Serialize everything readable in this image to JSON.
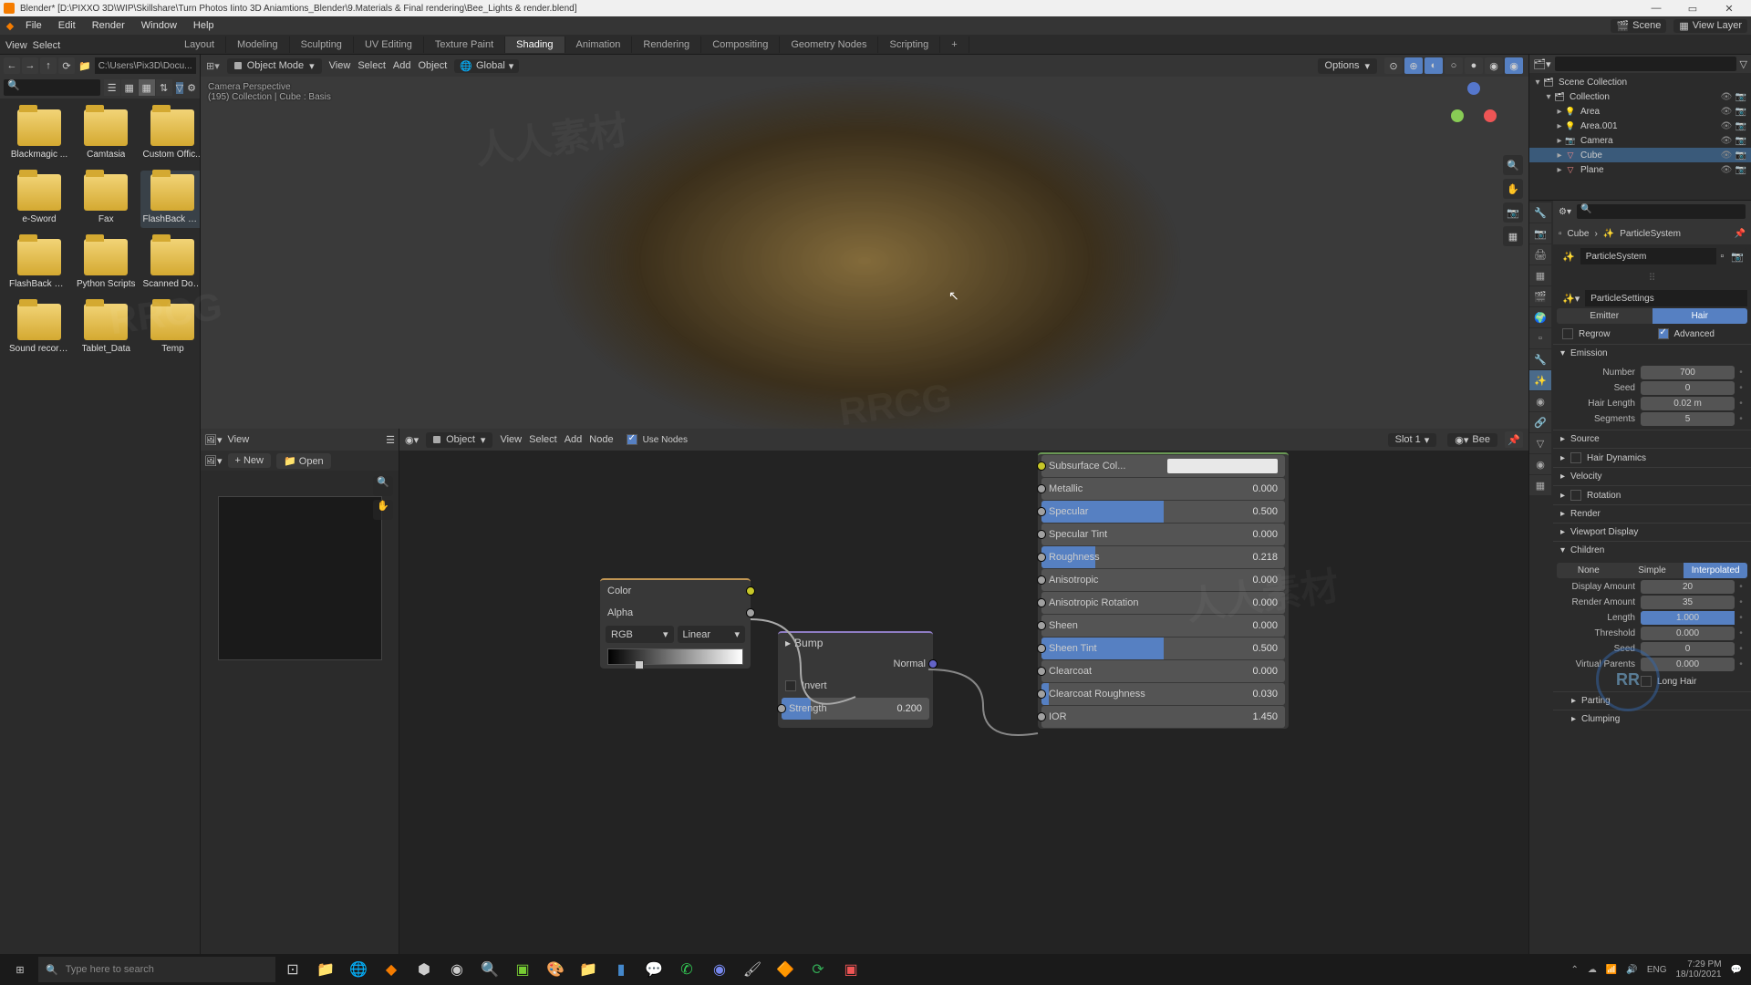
{
  "window": {
    "title": "Blender* [D:\\PIXXO 3D\\WIP\\Skillshare\\Turn Photos Iinto 3D Aniamtions_Blender\\9.Materials & Final rendering\\Bee_Lights & render.blend]"
  },
  "menubar": [
    "File",
    "Edit",
    "Render",
    "Window",
    "Help"
  ],
  "scene_name": "Scene",
  "viewlayer_name": "View Layer",
  "workspace_tabs": [
    "Layout",
    "Modeling",
    "Sculpting",
    "UV Editing",
    "Texture Paint",
    "Shading",
    "Animation",
    "Rendering",
    "Compositing",
    "Geometry Nodes",
    "Scripting"
  ],
  "active_workspace": "Shading",
  "topbar_menus": [
    "View",
    "Select"
  ],
  "filebrowser": {
    "path": "C:\\Users\\Pix3D\\Docu...",
    "search_placeholder": "",
    "items": [
      {
        "name": "Blackmagic ..."
      },
      {
        "name": "Camtasia"
      },
      {
        "name": "Custom Offic..."
      },
      {
        "name": "e-Sword"
      },
      {
        "name": "Fax"
      },
      {
        "name": "FlashBack Mo...",
        "selected": true
      },
      {
        "name": "FlashBack Pr..."
      },
      {
        "name": "Python Scripts"
      },
      {
        "name": "Scanned Doc..."
      },
      {
        "name": "Sound recordi..."
      },
      {
        "name": "Tablet_Data"
      },
      {
        "name": "Temp"
      }
    ]
  },
  "viewport": {
    "mode": "Object Mode",
    "menus": [
      "View",
      "Select",
      "Add",
      "Object"
    ],
    "overlay_top": "Camera Perspective",
    "overlay_frame": "(195) Collection | Cube : Basis",
    "orientation": "Global",
    "options_label": "Options"
  },
  "nodeeditor": {
    "left_view": "View",
    "left_new": "New",
    "left_open": "Open",
    "object_mode": "Object",
    "menus": [
      "View",
      "Select",
      "Add",
      "Node"
    ],
    "use_nodes_label": "Use Nodes",
    "slot": "Slot 1",
    "material": "Bee"
  },
  "bsdf_rows": [
    {
      "label": "Subsurface Col...",
      "val": "",
      "color": true,
      "fill": 0
    },
    {
      "label": "Metallic",
      "val": "0.000",
      "fill": 0
    },
    {
      "label": "Specular",
      "val": "0.500",
      "fill": 50
    },
    {
      "label": "Specular Tint",
      "val": "0.000",
      "fill": 0
    },
    {
      "label": "Roughness",
      "val": "0.218",
      "fill": 22
    },
    {
      "label": "Anisotropic",
      "val": "0.000",
      "fill": 0
    },
    {
      "label": "Anisotropic Rotation",
      "val": "0.000",
      "fill": 0
    },
    {
      "label": "Sheen",
      "val": "0.000",
      "fill": 0
    },
    {
      "label": "Sheen Tint",
      "val": "0.500",
      "fill": 50
    },
    {
      "label": "Clearcoat",
      "val": "0.000",
      "fill": 0
    },
    {
      "label": "Clearcoat Roughness",
      "val": "0.030",
      "fill": 3
    },
    {
      "label": "IOR",
      "val": "1.450",
      "fill": 0
    }
  ],
  "bump_node": {
    "title": "Bump",
    "invert": "Invert",
    "strength": "Strength",
    "strength_val": "0.200",
    "normal": "Normal"
  },
  "img_node": {
    "color": "Color",
    "alpha": "Alpha",
    "color_space": "RGB",
    "interp": "Linear"
  },
  "outliner": {
    "root": "Scene Collection",
    "items": [
      {
        "type": "col",
        "label": "Collection",
        "depth": 1,
        "expand": true
      },
      {
        "type": "light",
        "label": "Area",
        "depth": 2
      },
      {
        "type": "light",
        "label": "Area.001",
        "depth": 2
      },
      {
        "type": "cam",
        "label": "Camera",
        "depth": 2
      },
      {
        "type": "mesh",
        "label": "Cube",
        "depth": 2,
        "selected": true
      },
      {
        "type": "mesh",
        "label": "Plane",
        "depth": 2
      }
    ]
  },
  "properties": {
    "search_placeholder": "",
    "crumb_obj": "Cube",
    "crumb_ps": "ParticleSystem",
    "ps_name": "ParticleSystem",
    "settings_name": "ParticleSettings",
    "type_options": [
      "Emitter",
      "Hair"
    ],
    "type_active": "Hair",
    "regrow": "Regrow",
    "advanced": "Advanced",
    "emission": {
      "title": "Emission",
      "number_label": "Number",
      "number": "700",
      "seed_label": "Seed",
      "seed": "0",
      "hairlen_label": "Hair Length",
      "hairlen": "0.02 m",
      "segments_label": "Segments",
      "segments": "5"
    },
    "sections": [
      "Source",
      "Hair Dynamics",
      "Velocity",
      "Rotation",
      "Render",
      "Viewport Display"
    ],
    "children": {
      "title": "Children",
      "modes": [
        "None",
        "Simple",
        "Interpolated"
      ],
      "mode_active": "Interpolated",
      "disp_amt_label": "Display Amount",
      "disp_amt": "20",
      "rend_amt_label": "Render Amount",
      "rend_amt": "35",
      "length_label": "Length",
      "length": "1.000",
      "threshold_label": "Threshold",
      "threshold": "0.000",
      "seed_label": "Seed",
      "seed": "0",
      "vparents_label": "Virtual Parents",
      "vparents": "0.000",
      "longhair": "Long Hair"
    },
    "children_sub": [
      "Parting",
      "Clumping"
    ]
  },
  "taskbar": {
    "search_placeholder": "Type here to search",
    "lang": "ENG",
    "time": "7:29 PM",
    "date": "18/10/2021"
  }
}
